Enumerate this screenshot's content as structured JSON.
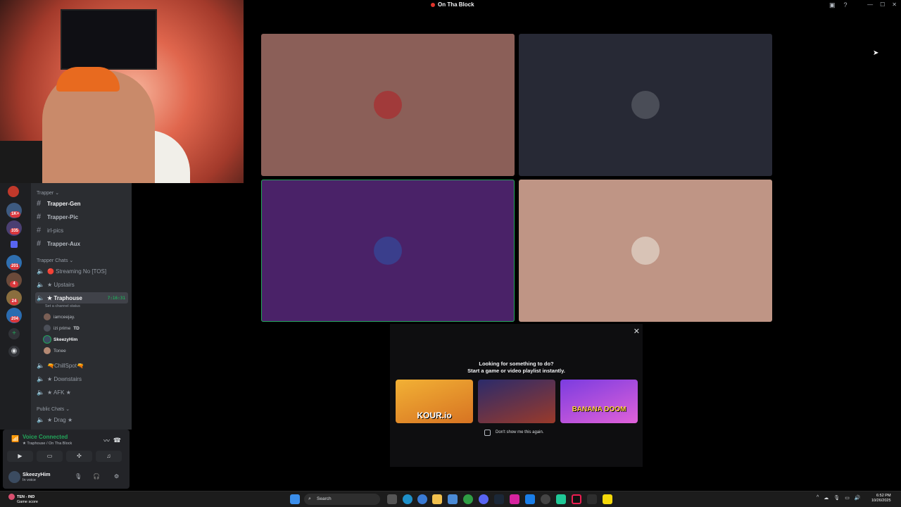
{
  "window": {
    "title": "On Tha Block"
  },
  "servers": {
    "badges": [
      "1K+",
      "335",
      "201",
      "4",
      "24",
      "204"
    ]
  },
  "channels": {
    "categories": {
      "trapper": "Trapper",
      "trapper_chats": "Trapper Chats",
      "public_chats": "Public Chats"
    },
    "text": [
      "Trapper-Gen",
      "Trapper-Pic",
      "irl-pics",
      "Trapper-Aux"
    ],
    "voice": {
      "streaming": "🔴 Streaming No  [TOS]",
      "upstairs": "★ Upstairs",
      "traphouse": "★ Traphouse",
      "traphouse_timer": "7:16:31",
      "traphouse_status": "Set a channel status",
      "chillspot": "🔫ChillSpot🔫",
      "downstairs": "★ Downstairs",
      "afk": "★ AFK ★",
      "drag": "★ Drag ★"
    },
    "users": [
      "iamceejay.",
      "izi prime",
      "SkeezyHim",
      "Tonee"
    ],
    "izi_tag": "TD"
  },
  "voice_panel": {
    "status": "Voice Connected",
    "location": "★ Traphouse / On Tha Block"
  },
  "user_panel": {
    "name": "SkeezyHim",
    "status": "In voice"
  },
  "popup": {
    "heading1": "Looking for something to do?",
    "heading2": "Start a game or video playlist instantly.",
    "games": [
      "KOUR.io",
      "",
      "BANANA DOOM"
    ],
    "checkbox_label": "Don't show me this again."
  },
  "taskbar": {
    "weather_title": "TEN - IND",
    "weather_sub": "Game score",
    "search_placeholder": "Search",
    "time": "6:52 PM",
    "date": "10/26/2025"
  },
  "colors": {
    "tile1": "#8b5f58",
    "tile2": "#272935",
    "tile3": "#4a2268",
    "tile4": "#bf9585",
    "speaking": "#23a55a"
  }
}
